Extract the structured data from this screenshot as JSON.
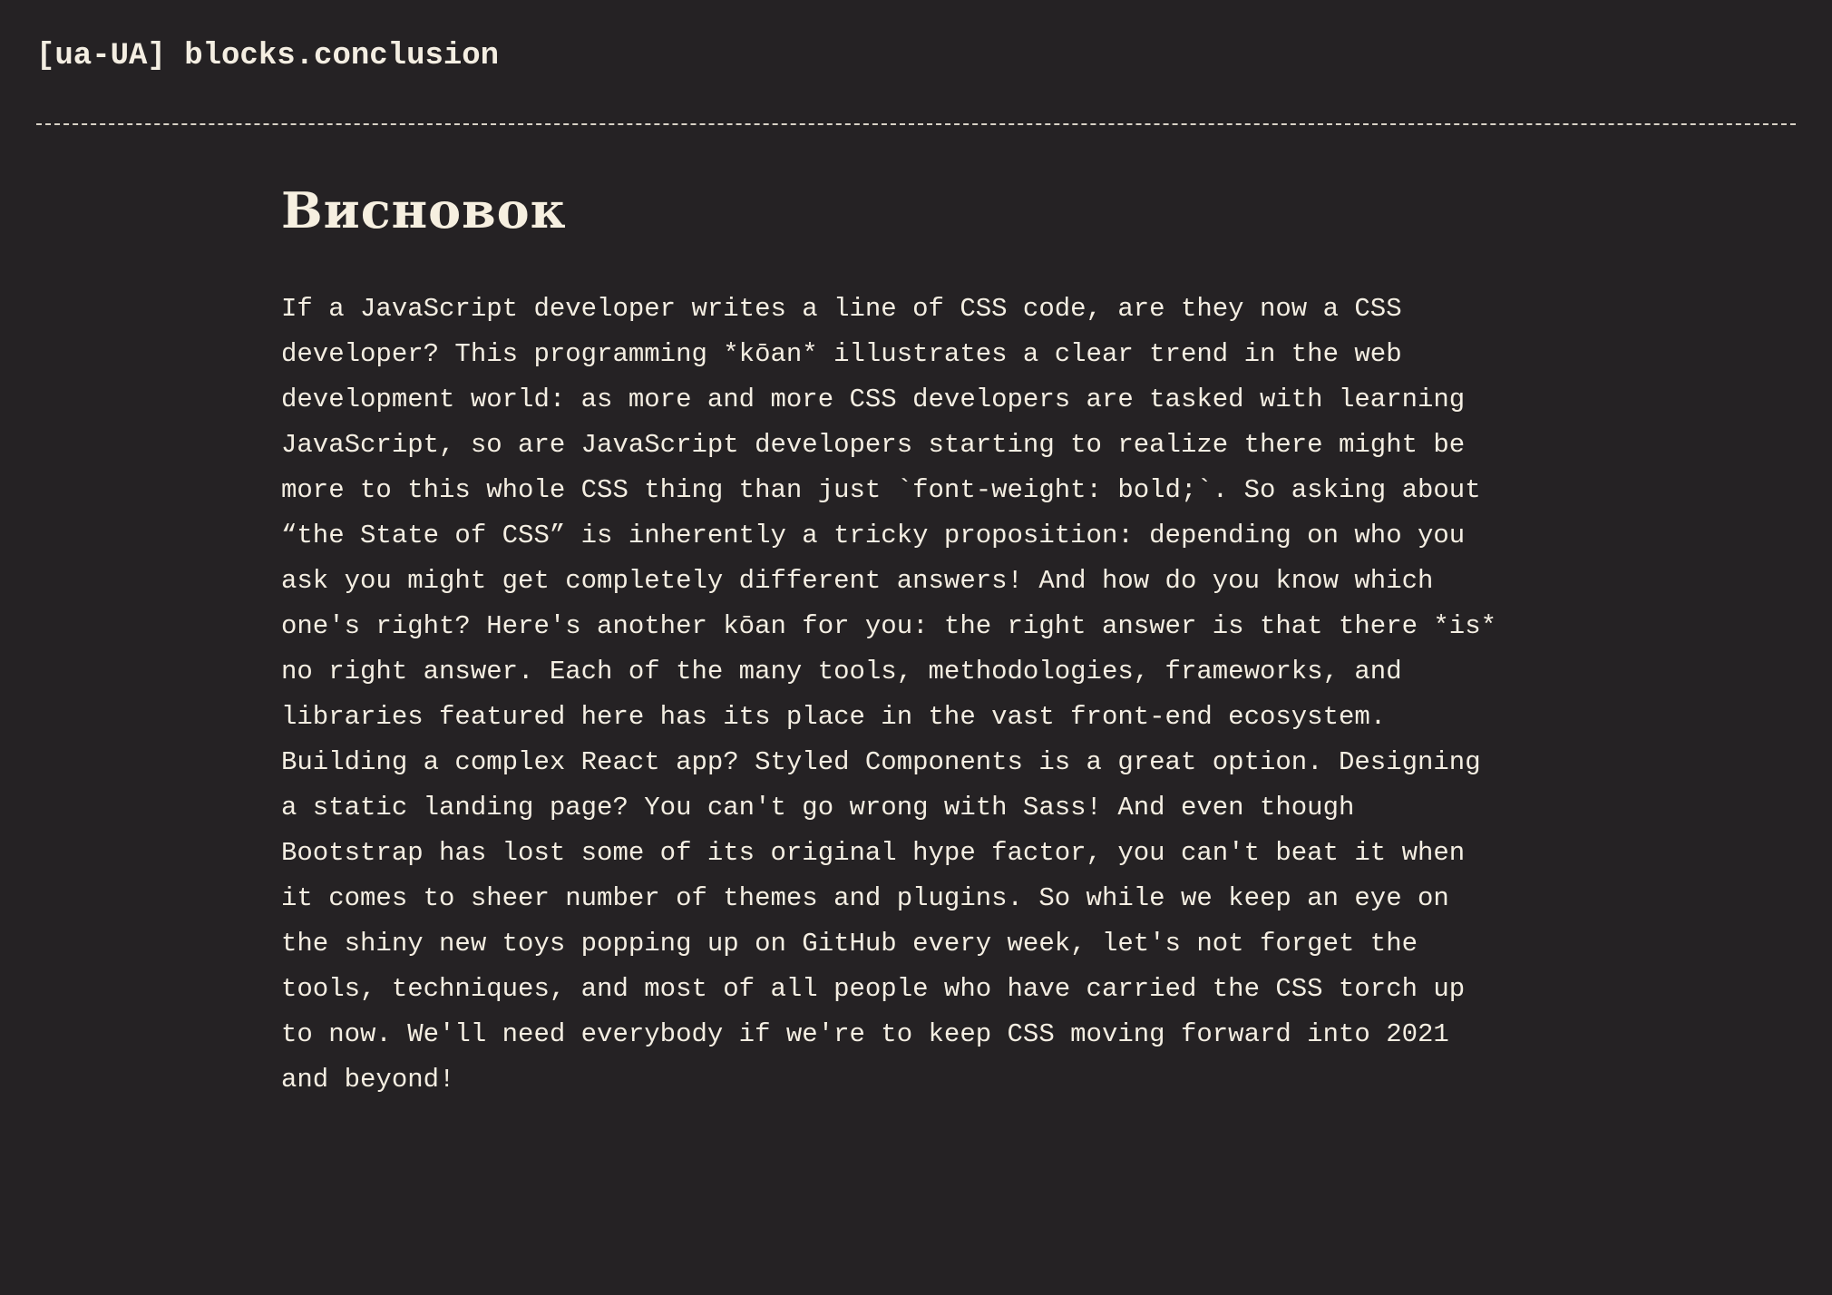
{
  "header": {
    "title": "[ua-UA] blocks.conclusion"
  },
  "main": {
    "heading": "Висновок",
    "lines": [
      "If a JavaScript developer writes a line of CSS code, are they now a CSS",
      "developer? This programming *kōan* illustrates a clear trend in the web",
      "development world: as more and more CSS developers are tasked with learning",
      "JavaScript, so are JavaScript developers starting to realize there might be",
      "more to this whole CSS thing than just `font-weight: bold;`. So asking about",
      "“the State of CSS” is inherently a tricky proposition: depending on who you",
      "ask you might get completely different answers! And how do you know which",
      "one's right? Here's another kōan for you: the right answer is that there *is*",
      "no right answer. Each of the many tools, methodologies, frameworks, and",
      "libraries featured here has its place in the vast front-end ecosystem.",
      "Building a complex React app? Styled Components is a great option. Designing",
      "a static landing page? You can't go wrong with Sass! And even though",
      "Bootstrap has lost some of its original hype factor, you can't beat it when",
      "it comes to sheer number of themes and plugins. So while we keep an eye on",
      "the shiny new toys popping up on GitHub every week, let's not forget the",
      "tools, techniques, and most of all people who have carried the CSS torch up",
      "to now. We'll need everybody if we're to keep CSS moving forward into 2021",
      "and beyond!"
    ]
  },
  "colors": {
    "background": "#252224",
    "text": "#f4eee2"
  }
}
